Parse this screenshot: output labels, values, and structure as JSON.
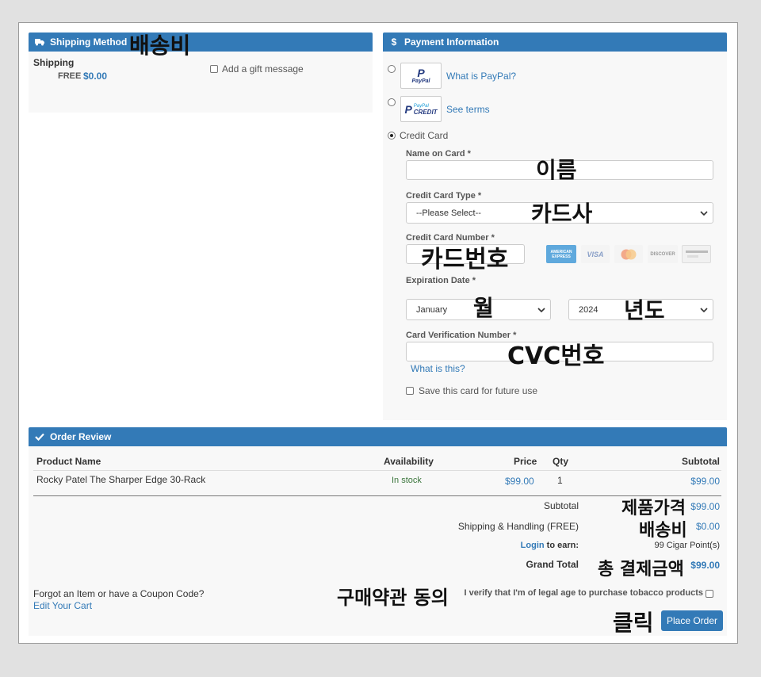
{
  "shipping": {
    "header": "Shipping Method",
    "label": "Shipping",
    "free": "FREE",
    "price": "$0.00",
    "gift": "Add a gift message"
  },
  "payment": {
    "header": "Payment Information",
    "paypal_link": "What is PayPal?",
    "paypal_logo": "PayPal",
    "credit_link": "See terms",
    "credit_logo": "CREDIT",
    "credit_logo_top": "PayPal",
    "credit_card": "Credit Card",
    "name_label": "Name on Card *",
    "type_label": "Credit Card Type *",
    "type_value": "--Please Select--",
    "number_label": "Credit Card Number *",
    "exp_label": "Expiration Date *",
    "month": "January",
    "year": "2024",
    "cvv_label": "Card Verification Number *",
    "what_is_this": "What is this?",
    "save_card": "Save this card for future use",
    "cards": [
      "AMERICAN EXPRESS",
      "VISA",
      "MasterCard",
      "DISCOVER",
      "Card"
    ]
  },
  "review": {
    "header": "Order Review",
    "columns": [
      "Product Name",
      "Availability",
      "Price",
      "Qty",
      "Subtotal"
    ],
    "item": {
      "name": "Rocky Patel The Sharper Edge 30-Rack",
      "availability": "In stock",
      "price": "$99.00",
      "qty": "1",
      "subtotal": "$99.00"
    },
    "subtotal_label": "Subtotal",
    "subtotal_value": "$99.00",
    "shipping_label": "Shipping & Handling (FREE)",
    "shipping_value": "$0.00",
    "login": "Login",
    "to_earn": " to earn:",
    "points": "99 Cigar Point(s)",
    "grand_label": "Grand Total",
    "grand_value": "$99.00",
    "forgot": "Forgot an Item or have a Coupon Code?",
    "edit_cart": "Edit Your Cart",
    "verify": "I verify that I'm of legal age to purchase tobacco products",
    "place_order": "Place Order"
  },
  "annotations": {
    "shipping_fee": "배송비",
    "name": "이름",
    "card_company": "카드사",
    "card_number": "카드번호",
    "month": "월",
    "year": "년도",
    "cvc": "CVC번호",
    "product_price": "제품가격",
    "shipping_fee2": "배송비",
    "total": "총 결제금액",
    "terms_agree": "구매약관 동의",
    "click": "클릭"
  },
  "colors": {
    "accent": "#337ab7",
    "in_stock": "#3c763d"
  }
}
